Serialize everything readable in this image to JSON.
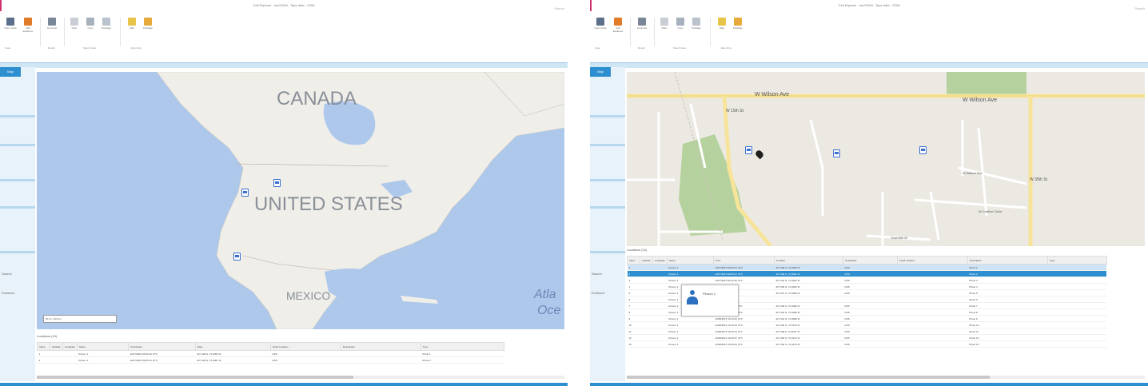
{
  "left": {
    "window_title": "Cell Explorer - ion/CDMI - Tape date - CDM",
    "search_text": "Search",
    "ribbon": {
      "buttons": [
        "Open Case",
        "Add Evidence",
        "Generate",
        "Filter",
        "Copy",
        "Package",
        "Map",
        "Package"
      ],
      "groups": [
        "Case",
        "Report",
        "Select Case",
        "Exporting"
      ]
    },
    "nav": {
      "tab": "Map",
      "labels": [
        "Search",
        "Evidence"
      ]
    },
    "map": {
      "labels": [
        "CANADA",
        "UNITED STATES",
        "MEXICO",
        "Atla",
        "Oce"
      ],
      "scale_text": "50 mi / 100 km"
    },
    "grid_title": "Locations (10)",
    "columns": [
      "Index",
      "Latitude",
      "Longitude",
      "Name",
      "Coordinate",
      "Date",
      "Fixed Location",
      "Description",
      "Type"
    ],
    "rows": [
      [
        "1",
        "",
        "",
        "Person 1",
        "12/07/2015 09:00:10 UTC",
        "40.7128 N, 74.0060 W",
        "GPS",
        "",
        "Photo 1"
      ],
      [
        "2",
        "",
        "",
        "Person 1",
        "12/07/2015 09:05:21 UTC",
        "40.7130 N, 74.0061 W",
        "GPS",
        "",
        "Photo 2"
      ]
    ]
  },
  "right": {
    "window_title": "Cell Explorer - ion/CDMI - Tape date - CDM",
    "search_text": "Search",
    "ribbon": {
      "buttons": [
        "Open Case",
        "Add Evidence",
        "Generate",
        "Filter",
        "Copy",
        "Package",
        "Map",
        "Package"
      ],
      "groups": [
        "Case",
        "Report",
        "Select Case",
        "Exporting"
      ]
    },
    "nav": {
      "tab": "Map",
      "labels": [
        "Search",
        "Evidence"
      ]
    },
    "map": {
      "streets": [
        "W Wilson Ave",
        "W Wilson Ave",
        "W Wilson Ave",
        "W Crafton Circle",
        "W 35th St",
        "W 15th St",
        "Yosemite Dr"
      ]
    },
    "popup": {
      "name": "Person 1"
    },
    "grid_title": "Locations (10)",
    "columns": [
      "Index",
      "Latitude",
      "Longitude",
      "Name",
      "Time",
      "Location",
      "Coordinate",
      "Fixed Location",
      "Description",
      "Type"
    ],
    "rows": [
      [
        "1",
        "",
        "",
        "Person 1",
        "12/07/2015 09:00:10 UTC",
        "40.7128 N, 74.0060 W",
        "GPS",
        "",
        "Photo 1",
        ""
      ],
      [
        "2",
        "",
        "",
        "Person 1",
        "12/07/2015 09:05:21 UTC",
        "40.7130 N, 74.0061 W",
        "GPS",
        "",
        "Photo 2",
        ""
      ],
      [
        "3",
        "",
        "",
        "Person 1",
        "12/07/2015 09:12:30 UTC",
        "40.7132 N, 74.0062 W",
        "GPS",
        "",
        "Photo 3",
        ""
      ],
      [
        "4",
        "",
        "",
        "Person 1",
        "",
        "40.7135 N, 74.0063 W",
        "GPS",
        "",
        "Photo 4",
        ""
      ],
      [
        "5",
        "",
        "",
        "Person 1",
        "",
        "40.7137 N, 74.0065 W",
        "GPS",
        "",
        "Photo 5",
        ""
      ],
      [
        "6",
        "",
        "",
        "Person 1",
        "",
        "",
        "",
        "",
        "Photo 6",
        ""
      ],
      [
        "7",
        "",
        "",
        "Person 1",
        "12/08/2015 10:01:11 UTC",
        "40.7140 N, 74.0066 W",
        "GPS",
        "",
        "Photo 7",
        ""
      ],
      [
        "8",
        "",
        "",
        "Person 1",
        "12/08/2015 10:04:33 UTC",
        "40.7142 N, 74.0068 W",
        "GPS",
        "",
        "Photo 8",
        ""
      ],
      [
        "9",
        "",
        "",
        "Person 1",
        "12/08/2015 10:10:02 UTC",
        "40.7144 N, 74.0069 W",
        "GPS",
        "",
        "Photo 9",
        ""
      ],
      [
        "10",
        "",
        "",
        "Person 1",
        "12/08/2015 10:15:44 UTC",
        "40.7146 N, 74.0070 W",
        "GPS",
        "",
        "Photo 10",
        ""
      ],
      [
        "11",
        "",
        "",
        "Person 1",
        "12/08/2015 10:20:19 UTC",
        "40.7148 N, 74.0071 W",
        "GPS",
        "",
        "Photo 11",
        ""
      ],
      [
        "12",
        "",
        "",
        "Person 1",
        "12/08/2015 10:25:57 UTC",
        "40.7150 N, 74.0072 W",
        "GPS",
        "",
        "Photo 12",
        ""
      ],
      [
        "13",
        "",
        "",
        "Person 1",
        "12/08/2015 10:30:40 UTC",
        "40.7152 N, 74.0074 W",
        "GPS",
        "",
        "Photo 13",
        ""
      ]
    ]
  },
  "colors": {
    "accent": "#d0316f",
    "selection": "#2d8fd0",
    "water": "#aec8ec",
    "land": "#efeee9",
    "park": "#b5d29e",
    "road": "#f7e49a"
  }
}
